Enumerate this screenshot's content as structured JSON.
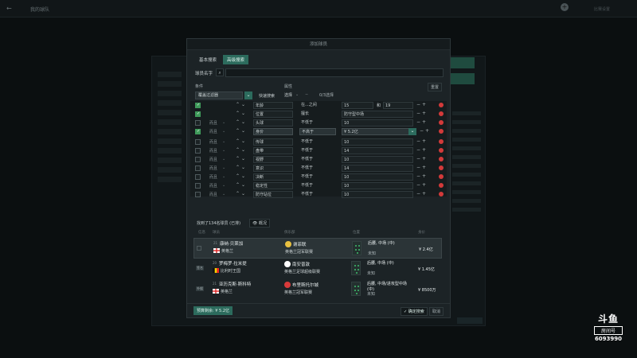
{
  "app": {
    "back_arrow": "←",
    "page_title": "我的球队",
    "add_symbol": "+",
    "right_label": "比赛设置"
  },
  "modal": {
    "title": "添加球员",
    "tabs": [
      {
        "label": "基本搜索",
        "active": false
      },
      {
        "label": "高级搜索",
        "active": true
      }
    ],
    "name_label": "球员名字",
    "name_value": "",
    "search_icon_glyph": "⌕",
    "condition_label": "条件",
    "attribute_label": "属性",
    "reset_label": "重置",
    "filter_select_value": "覆盖过滤器",
    "quick_search_label": "快速搜索",
    "attr_choose": "选择",
    "attr_chevron": "⌄",
    "attr_minus": "−",
    "attr_count": "0/3选择",
    "dropdown_glyph": "⌄"
  },
  "filter_rows": [
    {
      "checked": true,
      "prefix": "",
      "field": "年龄",
      "op": "在...之间",
      "value": "15",
      "value2": "19",
      "range_label": "和",
      "highlighted": false
    },
    {
      "checked": true,
      "prefix": "",
      "field": "位置",
      "op": "擅长",
      "value": "防守型中场",
      "value2": "",
      "range_label": "",
      "highlighted": false
    },
    {
      "checked": false,
      "prefix": "而且",
      "field": "头球",
      "op": "不低于",
      "value": "10",
      "value2": "",
      "range_label": "",
      "highlighted": false
    },
    {
      "checked": true,
      "prefix": "而且",
      "field": "身价",
      "op": "不高于",
      "value": "¥ 5.2亿",
      "value2": "",
      "range_label": "",
      "highlighted": true
    },
    {
      "checked": false,
      "prefix": "而且",
      "field": "传球",
      "op": "不低于",
      "value": "10",
      "value2": "",
      "range_label": "",
      "highlighted": false
    },
    {
      "checked": false,
      "prefix": "而且",
      "field": "盘带",
      "op": "不低于",
      "value": "14",
      "value2": "",
      "range_label": "",
      "highlighted": false
    },
    {
      "checked": false,
      "prefix": "而且",
      "field": "视野",
      "op": "不低于",
      "value": "10",
      "value2": "",
      "range_label": "",
      "highlighted": false
    },
    {
      "checked": false,
      "prefix": "而且",
      "field": "意识",
      "op": "不低于",
      "value": "14",
      "value2": "",
      "range_label": "",
      "highlighted": false
    },
    {
      "checked": false,
      "prefix": "而且",
      "field": "决断",
      "op": "不低于",
      "value": "10",
      "value2": "",
      "range_label": "",
      "highlighted": false
    },
    {
      "checked": false,
      "prefix": "而且",
      "field": "稳定性",
      "op": "不低于",
      "value": "10",
      "value2": "",
      "range_label": "",
      "highlighted": false
    },
    {
      "checked": false,
      "prefix": "而且",
      "field": "防守站位",
      "op": "不低于",
      "value": "10",
      "value2": "",
      "range_label": "",
      "highlighted": false
    }
  ],
  "glyphs": {
    "arrows": "⌃⌄",
    "stepper": "−+",
    "pre_dd": "⌄",
    "check": "✓"
  },
  "results": {
    "summary": "找到了134名球员 (已排)",
    "view_label": "概况",
    "view_icon": "eye-icon",
    "columns": [
      "信息",
      "球员",
      "俱乐部",
      "位置",
      "身价"
    ],
    "players": [
      {
        "chip": "",
        "pos_tag": "21",
        "name": "康纳·贝莱加",
        "nation": "英格兰",
        "flag": "england",
        "club": "谢菲联",
        "league": "英格兰冠军联赛",
        "role": "后腰, 中场 (中)",
        "foot": "未知",
        "price": "¥ 2.4亿",
        "selected": true,
        "club_color": "#e8c040"
      },
      {
        "chip": "签名",
        "pos_tag": "20",
        "name": "罗梅罗·拉米提",
        "nation": "比利时王国",
        "flag": "belgium",
        "club": "南安普敦",
        "league": "英格兰足球超级联赛",
        "role": "后腰, 中场 (中)",
        "foot": "未知",
        "price": "¥ 1.45亿",
        "selected": false,
        "club_color": "#ffffff"
      },
      {
        "chip": "外援",
        "pos_tag": "21",
        "name": "亚历克斯·斯科特",
        "nation": "英格兰",
        "flag": "england",
        "club": "布里斯托尔城",
        "league": "英格兰冠军联赛",
        "role": "后腰, 中场/进攻型中场 (中)",
        "foot": "未知",
        "price": "¥ 8500万",
        "selected": false,
        "club_color": "#d83a3a"
      }
    ]
  },
  "footer": {
    "budget_label": "预算剩余: ¥ 5.2亿",
    "confirm_label": "✓ 确定搜索",
    "cancel_label": "取消"
  },
  "watermark": {
    "logo": "斗鱼",
    "room_label": "房间号",
    "room_id": "6093990"
  },
  "colors": {
    "accent": "#2c6b5d",
    "checkbox_on": "#3f9a5a",
    "delete": "#d33a3a"
  }
}
